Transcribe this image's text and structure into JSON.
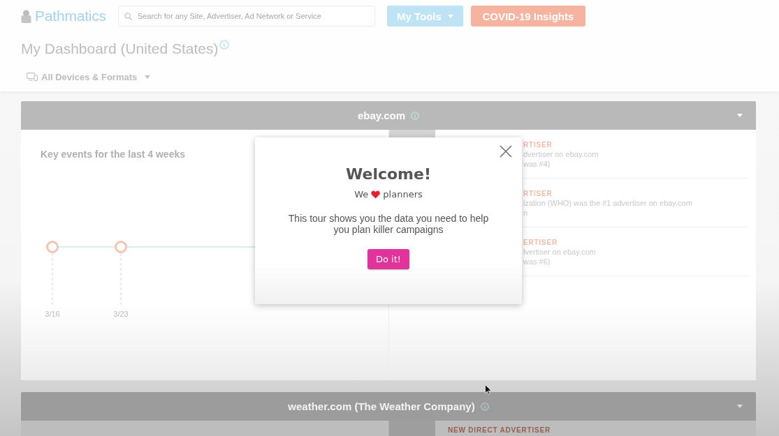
{
  "header": {
    "logo": "Pathmatics",
    "search": {
      "placeholder": "Search for any Site, Advertiser, Ad Network or Service"
    },
    "buttons": [
      {
        "label": "My Tools",
        "kind": "dropdown",
        "color": "#bde3f4"
      },
      {
        "label": "COVID-19 Insights",
        "kind": "plain",
        "color": "#f6b3a0"
      }
    ]
  },
  "page": {
    "title": "My Dashboard (United States)",
    "filter": "All Devices & Formats"
  },
  "cards": [
    {
      "title": "ebay.com",
      "timeline": {
        "title": "Key events for the last 4 weeks",
        "dates": [
          "3/16",
          "3/23"
        ]
      },
      "insights": [
        {
          "label": "RTISER",
          "lines": [
            "dvertiser on ebay.com",
            "was #4)"
          ]
        },
        {
          "label": "RTISER",
          "lines": [
            "ization (WHO) was the #1 advertiser on ebay.com",
            "n"
          ]
        },
        {
          "label": "ERTISER",
          "lines": [
            "lvertiser on ebay.com",
            "was #6)"
          ]
        }
      ]
    },
    {
      "title": "weather.com (The Weather Company)",
      "insights": [
        {
          "label": "NEW DIRECT ADVERTISER"
        }
      ]
    }
  ],
  "modal": {
    "title": "Welcome!",
    "tagline": {
      "before": "We",
      "after": "planners"
    },
    "body": "This tour shows you the data you need to help you plan killer campaigns",
    "button": "Do it!"
  }
}
